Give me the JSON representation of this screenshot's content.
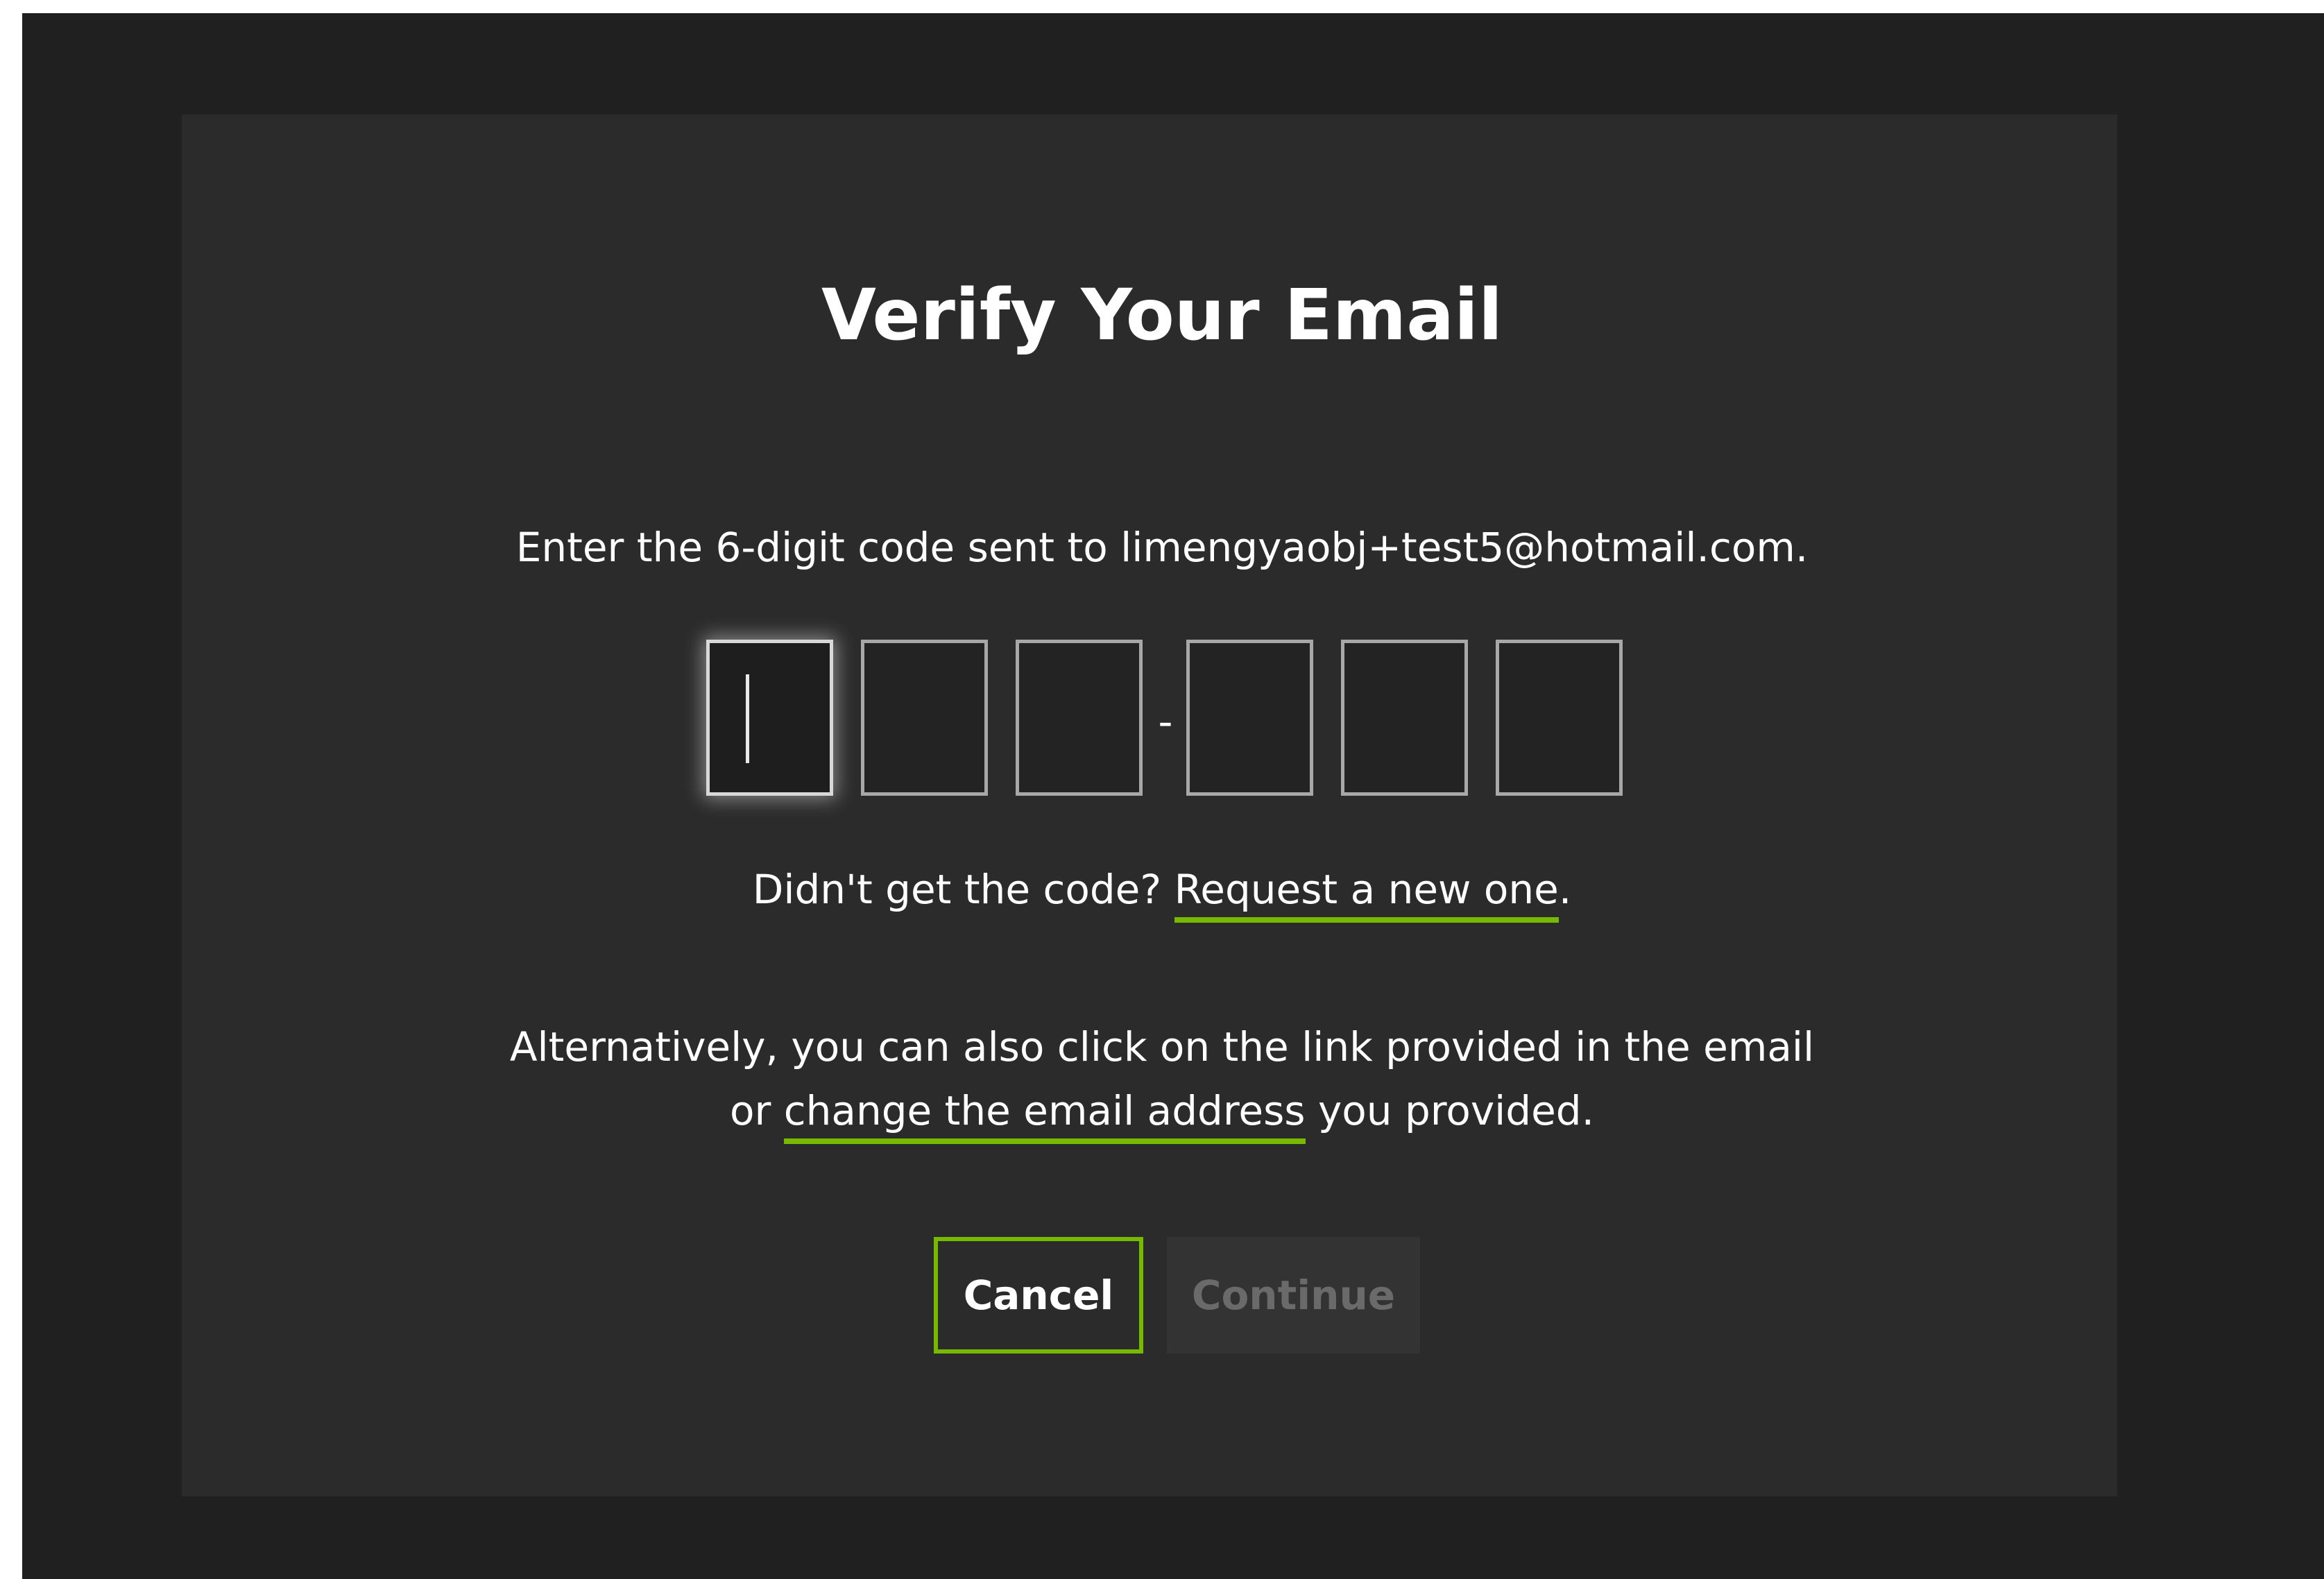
{
  "dialog": {
    "title": "Verify Your Email",
    "instruction": "Enter the 6-digit code sent to limengyaobj+test5@hotmail.com.",
    "code": {
      "digits": [
        "",
        "",
        "",
        "",
        "",
        ""
      ],
      "separator": "-"
    },
    "resend": {
      "prompt": "Didn't get the code? ",
      "link_label": "Request a new one",
      "suffix": "."
    },
    "alternative": {
      "line1": "Alternatively, you can also click on the link provided in the email",
      "line2_prefix": "or ",
      "link_label": "change the email address",
      "line2_suffix": " you provided."
    },
    "buttons": {
      "cancel_label": "Cancel",
      "continue_label": "Continue"
    }
  },
  "colors": {
    "page_background": "#202020",
    "card_background": "#2b2b2b",
    "accent": "#76b900",
    "disabled_text": "#6a6a6a"
  }
}
